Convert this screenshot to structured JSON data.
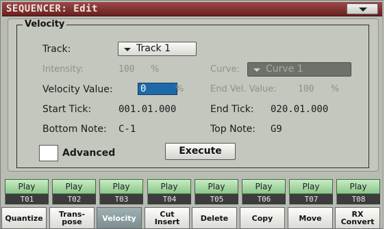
{
  "title": "SEQUENCER: Edit",
  "group_title": "Velocity",
  "track": {
    "label": "Track:",
    "value": "Track 1"
  },
  "intensity": {
    "label": "Intensity:",
    "value": "100",
    "unit": "%"
  },
  "curve": {
    "label": "Curve:",
    "value": "Curve 1"
  },
  "velocity_value": {
    "label": "Velocity Value:",
    "value": "0",
    "unit": "%"
  },
  "end_vel": {
    "label": "End Vel. Value:",
    "value": "100",
    "unit": "%"
  },
  "start_tick": {
    "label": "Start Tick:",
    "value": "001.01.000"
  },
  "end_tick": {
    "label": "End Tick:",
    "value": "020.01.000"
  },
  "bottom_note": {
    "label": "Bottom Note:",
    "value": "C-1"
  },
  "top_note": {
    "label": "Top Note:",
    "value": "G9"
  },
  "advanced_label": "Advanced",
  "execute_label": "Execute",
  "tracks": [
    {
      "play": "Play",
      "num": "T01"
    },
    {
      "play": "Play",
      "num": "T02"
    },
    {
      "play": "Play",
      "num": "T03"
    },
    {
      "play": "Play",
      "num": "T04"
    },
    {
      "play": "Play",
      "num": "T05"
    },
    {
      "play": "Play",
      "num": "T06"
    },
    {
      "play": "Play",
      "num": "T07"
    },
    {
      "play": "Play",
      "num": "T08"
    }
  ],
  "tabs": [
    {
      "line1": "Quantize",
      "line2": ""
    },
    {
      "line1": "Trans-",
      "line2": "pose"
    },
    {
      "line1": "Velocity",
      "line2": "",
      "active": true
    },
    {
      "line1": "Cut",
      "line2": "Insert"
    },
    {
      "line1": "Delete",
      "line2": ""
    },
    {
      "line1": "Copy",
      "line2": ""
    },
    {
      "line1": "Move",
      "line2": ""
    },
    {
      "line1": "RX",
      "line2": "Convert"
    }
  ]
}
